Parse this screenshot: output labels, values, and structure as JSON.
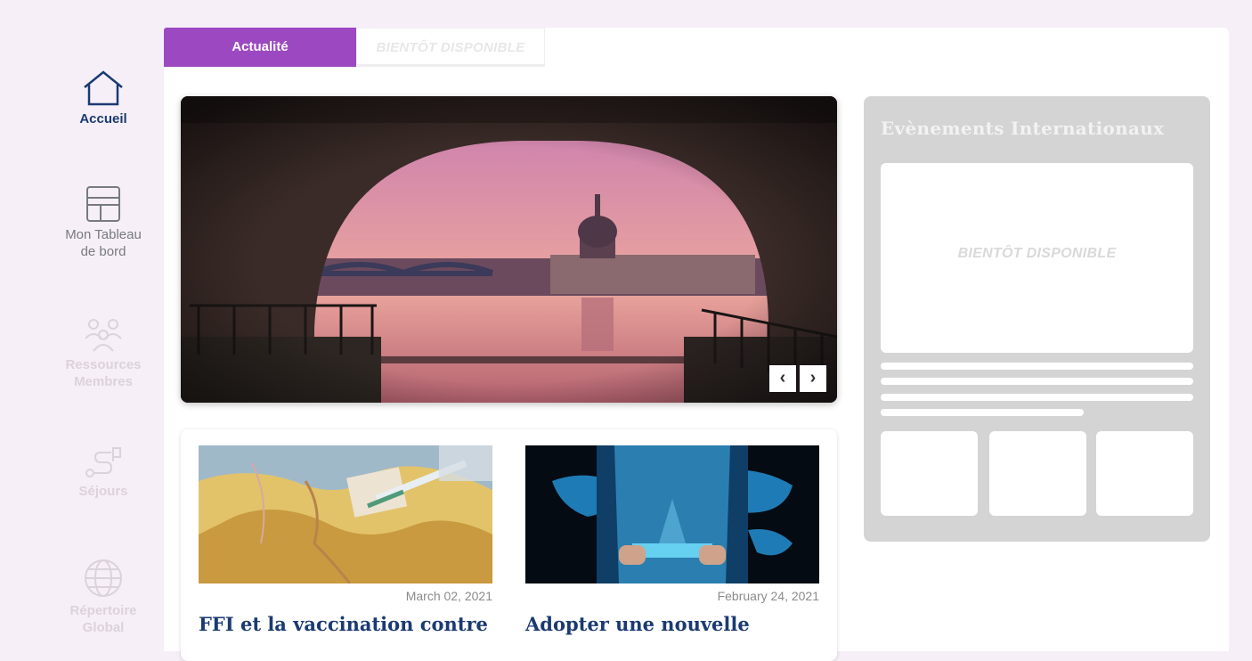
{
  "sidebar": {
    "items": [
      {
        "label_line1": "Accueil",
        "label_line2": "",
        "icon": "home-icon",
        "state": "active"
      },
      {
        "label_line1": "Mon Tableau",
        "label_line2": "de bord",
        "icon": "dashboard-icon",
        "state": "normal"
      },
      {
        "label_line1": "Ressources",
        "label_line2": "Membres",
        "icon": "people-icon",
        "state": "disabled"
      },
      {
        "label_line1": "Séjours",
        "label_line2": "",
        "icon": "route-icon",
        "state": "disabled"
      },
      {
        "label_line1": "Répertoire",
        "label_line2": "Global",
        "icon": "globe-icon",
        "state": "disabled"
      }
    ]
  },
  "tabs": {
    "active": "Actualité",
    "disabled": "BIENTÔT DISPONIBLE"
  },
  "carousel": {
    "prev_label": "‹",
    "next_label": "›"
  },
  "news": [
    {
      "date": "March 02, 2021",
      "title": "FFI et la vaccination contre"
    },
    {
      "date": "February 24, 2021",
      "title": "Adopter une nouvelle"
    }
  ],
  "events": {
    "title": "Evènements Internationaux",
    "placeholder": "BIENTÔT DISPONIBLE"
  },
  "colors": {
    "accent": "#9c49c1",
    "navy": "#1b3a72",
    "background": "#f6eff7",
    "panel_grey": "#d4d4d4"
  }
}
